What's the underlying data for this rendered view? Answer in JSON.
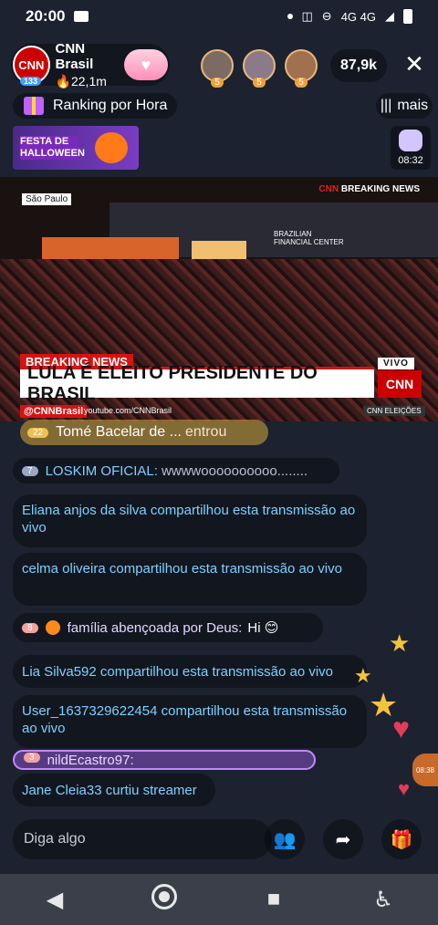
{
  "status_bar": {
    "time": "20:00",
    "network": "4G 4G"
  },
  "host": {
    "name": "CNN Brasil",
    "views": "22,1m",
    "level": "133",
    "logo_text": "CNN"
  },
  "viewers": {
    "count": "87,9k",
    "badges": [
      "5",
      "5",
      "5"
    ]
  },
  "ranking": {
    "label": "Ranking por Hora"
  },
  "more": {
    "label": "mais"
  },
  "promo": {
    "halloween_text": "FESTA DE HALLOWEEN",
    "bunny_timer": "08:32"
  },
  "video": {
    "location_tag": "São Paulo",
    "corner_logo": "BREAKING NEWS",
    "building_sign": "BRAZILIAN FINANCIAL CENTER",
    "breaking_label": "BREAKING NEWS",
    "headline": "LULA É ELEITO PRESIDENTE DO BRASIL",
    "vivo": "VIVO",
    "cnn_box": "CNN",
    "handle": "@CNNBrasil",
    "youtube": "youtube.com/CNNBrasil",
    "election_tag": "CNN ELEIÇÕES"
  },
  "chat": {
    "entered": {
      "level": "22",
      "name": "Tomé Bacelar de ...",
      "action": "entrou"
    },
    "m1": {
      "level": "7",
      "name": "LOSKIM OFICIAL:",
      "text": "wwwwoooooooooo........"
    },
    "m2": {
      "text": "Eliana anjos da silva compartilhou esta transmissão ao vivo"
    },
    "m3": {
      "text": "celma oliveira compartilhou esta transmissão ao vivo"
    },
    "m4": {
      "level": "8",
      "name": "família abençoada por Deus:",
      "text": "Hi 😊"
    },
    "m5": {
      "text": "Lia Silva592 compartilhou esta transmissão ao vivo"
    },
    "m6": {
      "text": "User_1637329622454 compartilhou esta transmissão ao vivo"
    },
    "m7": {
      "level": "3",
      "text": "nildEcastro97:"
    },
    "m8": {
      "text": "Jane Cleia33 curtiu streamer"
    }
  },
  "input": {
    "placeholder": "Diga algo"
  },
  "timer_badge": "08:38"
}
